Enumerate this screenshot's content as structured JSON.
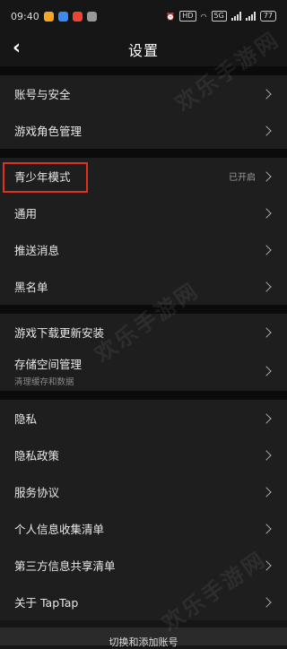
{
  "status_bar": {
    "time": "09:40",
    "network_badge": "HD",
    "network_badge2": "5G",
    "battery": "77"
  },
  "header": {
    "title": "设置",
    "back_icon": "chevron-left-icon"
  },
  "sections": {
    "account": [
      {
        "label": "账号与安全"
      },
      {
        "label": "游戏角色管理"
      }
    ],
    "general": [
      {
        "label": "青少年模式",
        "value": "已开启"
      },
      {
        "label": "通用"
      },
      {
        "label": "推送消息"
      },
      {
        "label": "黑名单"
      }
    ],
    "storage": [
      {
        "label": "游戏下载更新安装"
      },
      {
        "label": "存储空间管理",
        "sub": "清理缓存和数据"
      }
    ],
    "privacy": [
      {
        "label": "隐私"
      },
      {
        "label": "隐私政策"
      },
      {
        "label": "服务协议"
      },
      {
        "label": "个人信息收集清单"
      },
      {
        "label": "第三方信息共享清单"
      },
      {
        "label": "关于 TapTap"
      }
    ]
  },
  "bottom_button": {
    "label": "切换和添加账号"
  },
  "watermark": "欢乐手游网",
  "colors": {
    "highlight": "#e0301e",
    "background": "#161616",
    "row": "#1e1e1e"
  }
}
